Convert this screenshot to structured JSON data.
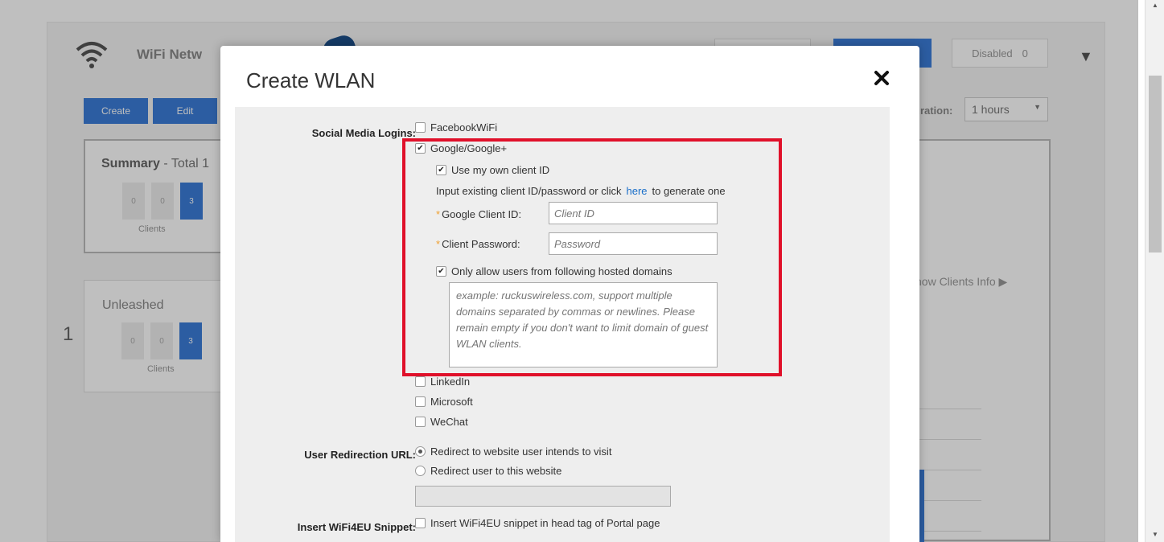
{
  "background": {
    "title": "WiFi Netw",
    "buttons": {
      "create": "Create",
      "edit": "Edit"
    },
    "disabled": {
      "label": "Disabled",
      "count": "0"
    },
    "duration": {
      "label": "uration:",
      "value": "1 hours"
    },
    "summary": {
      "title_bold": "Summary",
      "title_rest": " - Total 1",
      "minis": [
        "0",
        "0",
        "3"
      ],
      "clients_label": "Clients"
    },
    "unleashed": {
      "title": "Unleashed",
      "index": "1",
      "minis": [
        "0",
        "0",
        "3"
      ],
      "clients_label": "Clients"
    },
    "show_clients": "how Clients Info"
  },
  "modal": {
    "title": "Create WLAN",
    "social_media_label": "Social Media Logins:",
    "options": {
      "facebook": {
        "label": "FacebookWiFi",
        "checked": false
      },
      "google": {
        "label": "Google/Google+",
        "checked": true
      },
      "linkedin": {
        "label": "LinkedIn",
        "checked": false
      },
      "microsoft": {
        "label": "Microsoft",
        "checked": false
      },
      "wechat": {
        "label": "WeChat",
        "checked": false
      }
    },
    "google": {
      "own_client_id": {
        "label": "Use my own client ID",
        "checked": true
      },
      "hint_prefix": "Input existing client ID/password or click",
      "hint_link": "here",
      "hint_suffix": "to generate one",
      "client_id_label": "Google Client ID:",
      "client_id_placeholder": "Client ID",
      "password_label": "Client Password:",
      "password_placeholder": "Password",
      "hosted_domains": {
        "label": "Only allow users from following hosted domains",
        "checked": true
      },
      "domains_placeholder": "example: ruckuswireless.com,  support multiple domains separated by commas or newlines. Please remain empty if you don't want to limit domain of guest WLAN clients."
    },
    "redirection": {
      "label": "User Redirection URL:",
      "option_intended": "Redirect to website user intends to visit",
      "option_custom": "Redirect user to this website",
      "selected": "intended"
    },
    "wifi4eu": {
      "label": "Insert WiFi4EU Snippet:",
      "option": "Insert WiFi4EU snippet in head tag of Portal page",
      "checked": false
    }
  },
  "colors": {
    "accent": "#3b7dd8",
    "highlight": "#e0102a",
    "required": "#f0a030",
    "link": "#1a6fc9"
  },
  "icons": [
    "wifi-icon",
    "close-icon",
    "chevron-down-icon",
    "caret-right-icon"
  ]
}
